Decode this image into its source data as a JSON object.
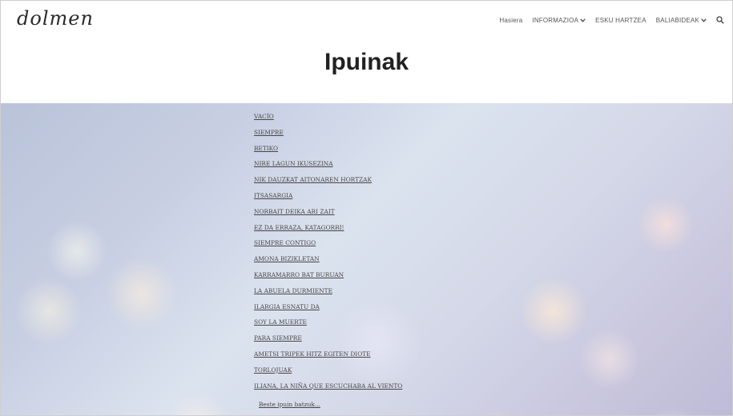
{
  "header": {
    "logo_text": "dolmen",
    "page_title": "Ipuinak"
  },
  "nav": {
    "items": [
      {
        "label": "Hasiera",
        "has_dropdown": false
      },
      {
        "label": "INFORMAZIOA",
        "has_dropdown": true
      },
      {
        "label": "ESKU HARTZEA",
        "has_dropdown": false
      },
      {
        "label": "BALIABIDEAK",
        "has_dropdown": true
      }
    ],
    "search_icon": "search-icon",
    "dropdown_icon": "chevron-down-icon"
  },
  "stories": [
    "VACÍO",
    "SIEMPRE",
    "BETIKO",
    "NIRE LAGUN IKUSEZINA",
    "NIK DAUZKAT AITONAREN HORTZAK",
    "ITSASARGIA",
    "NORBAIT DEIKA ARI ZAIT",
    "EZ DA ERRAZA, KATAGORRI!",
    "SIEMPRE CONTIGO",
    "AMONA BIZIKLETAN",
    "KARRAMARRO BAT BURUAN",
    "LA ABUELA DURMIENTE",
    "ILARGIA ESNATU DA",
    "SOY LA MUERTE",
    "PARA SIEMPRE",
    "AMETSI TRIPEK HITZ EGITEN DIOTE",
    "TORLOJUAK",
    "ILIANA, LA NIÑA QUE ESCUCHABA AL VIENTO"
  ],
  "more_link": "Beste ipuin batzuk..."
}
